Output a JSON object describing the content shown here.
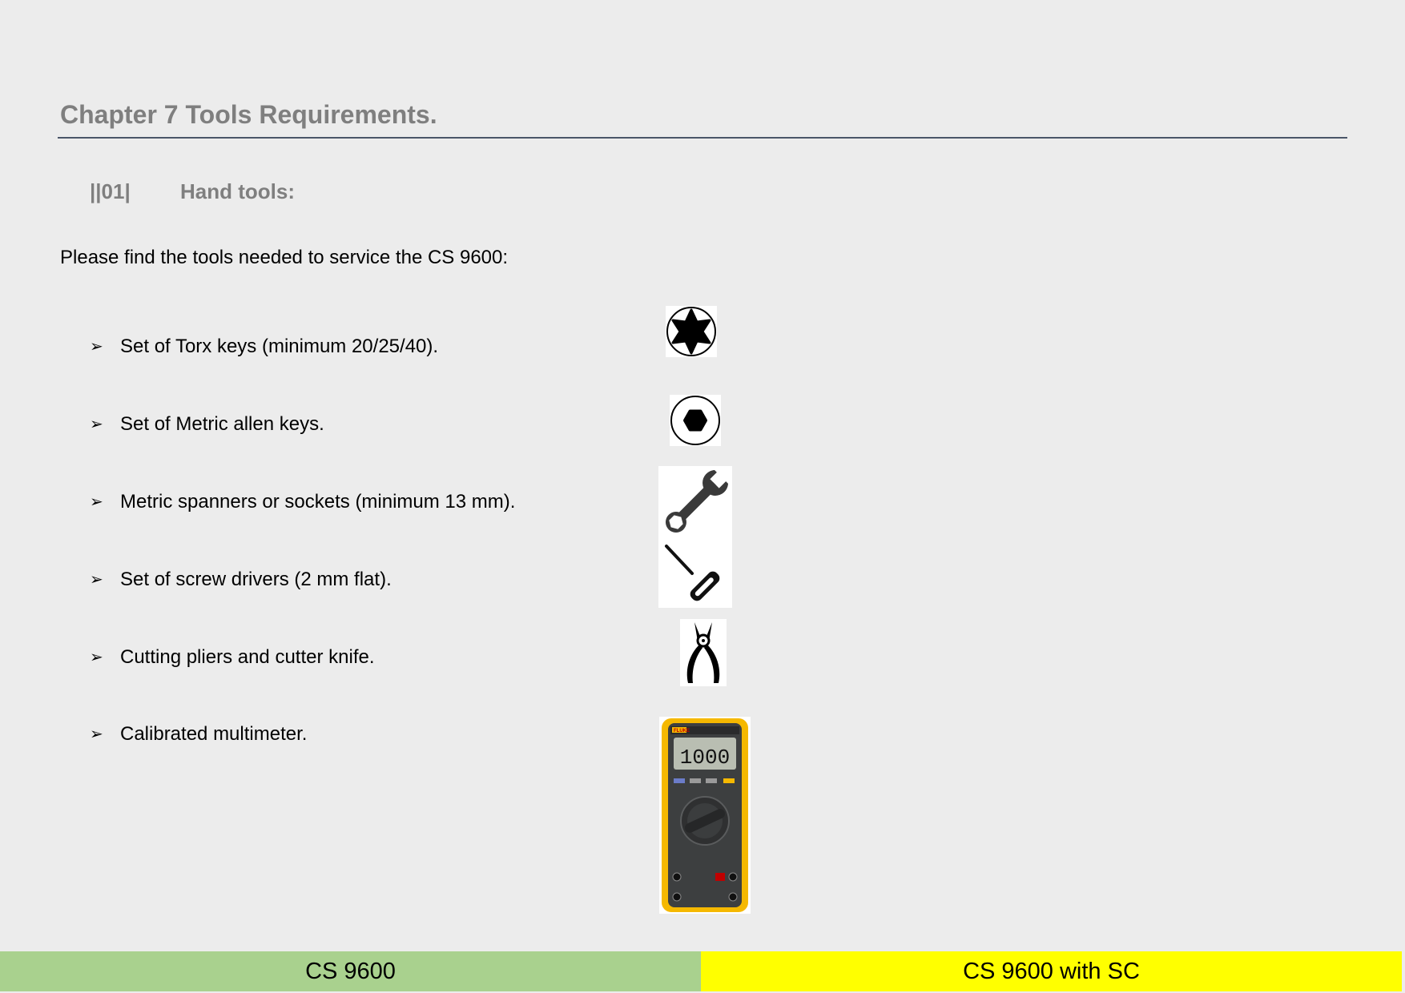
{
  "chapter_title": "Chapter 7 Tools Requirements.",
  "section": {
    "number": "||01|",
    "title": "Hand tools:"
  },
  "intro": "Please find the tools needed to service the CS 9600:",
  "bullet_glyph": "➢",
  "tools": [
    {
      "label": "Set of Torx keys (minimum 20/25/40).",
      "icon": "torx-icon"
    },
    {
      "label": "Set of Metric allen keys.",
      "icon": "hex-key-icon"
    },
    {
      "label": "Metric spanners or sockets (minimum 13 mm).",
      "icon": "wrench-icon"
    },
    {
      "label": "Set of screw drivers (2 mm flat).",
      "icon": "screwdriver-icon"
    },
    {
      "label": "Cutting pliers and cutter knife.",
      "icon": "pliers-icon"
    },
    {
      "label": "Calibrated multimeter.",
      "icon": "multimeter-icon"
    }
  ],
  "multimeter_display": "1000",
  "multimeter_brand": "FLUKE",
  "footer": {
    "left": "CS 9600",
    "right": "CS 9600 with SC",
    "left_color": "#a9d18e",
    "right_color": "#ffff00"
  }
}
